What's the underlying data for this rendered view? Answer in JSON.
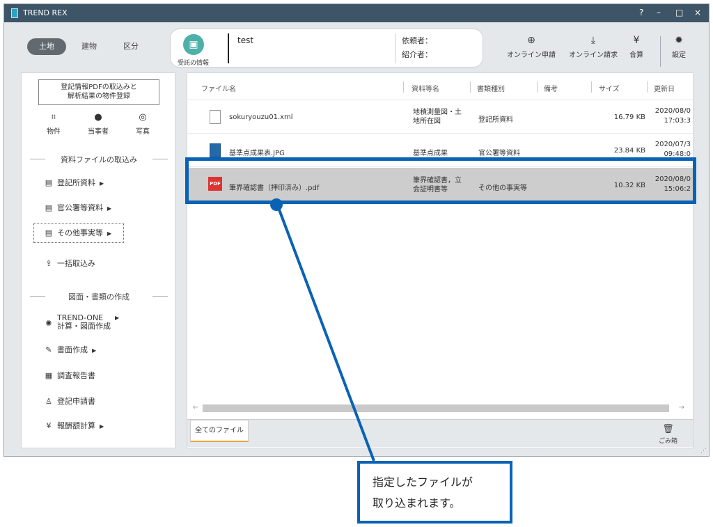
{
  "window": {
    "title": "TREND REX",
    "controls": [
      "?",
      "–",
      "□",
      "×"
    ]
  },
  "category_tabs": [
    {
      "label": "土地",
      "active": true
    },
    {
      "label": "建物",
      "active": false
    },
    {
      "label": "区分",
      "active": false
    }
  ],
  "context": {
    "entrust_label": "受託の情報",
    "project_name": "test",
    "requester": "依頼者：",
    "introducer": "紹介者："
  },
  "toolbar": [
    {
      "label": "オンライン申請",
      "icon": "globe-icon"
    },
    {
      "label": "オンライン請求",
      "icon": "download-icon"
    },
    {
      "label": "合算",
      "icon": "yen-icon"
    },
    {
      "label": "設定",
      "icon": "gear-icon"
    }
  ],
  "sidebar": {
    "import_button": [
      "登記情報PDFの取込みと",
      "解析結果の物件登録"
    ],
    "quick_items": [
      {
        "label": "物件",
        "icon": "property-icon"
      },
      {
        "label": "当事者",
        "icon": "person-icon"
      },
      {
        "label": "写真",
        "icon": "camera-icon"
      }
    ],
    "section1": "資料ファイルの取込み",
    "section1_items": [
      {
        "label": "登記所資料",
        "icon": "document-icon",
        "has_submenu": true
      },
      {
        "label": "官公署等資料",
        "icon": "document-icon",
        "has_submenu": true
      },
      {
        "label": "その他事実等",
        "icon": "document-icon",
        "has_submenu": true,
        "selected": true
      },
      {
        "label": "一括取込み",
        "icon": "batch-import-icon",
        "has_submenu": false
      }
    ],
    "section2": "図面・書類の作成",
    "section2_items": [
      {
        "label": "TREND-ONE\n計算・図面作成",
        "icon": "trend-one-icon",
        "has_submenu": true
      },
      {
        "label": "書面作成",
        "icon": "edit-document-icon",
        "has_submenu": true
      },
      {
        "label": "調査報告書",
        "icon": "report-icon",
        "has_submenu": false
      },
      {
        "label": "登記申請書",
        "icon": "application-icon",
        "has_submenu": false
      },
      {
        "label": "報酬額計算",
        "icon": "yen-icon",
        "has_submenu": true
      }
    ]
  },
  "file_table": {
    "columns": [
      "ファイル名",
      "資料等名",
      "書類種別",
      "備考",
      "サイズ",
      "更新日"
    ],
    "rows": [
      {
        "icon": "xml-file-icon",
        "name": "sokuryouzu01.xml",
        "doc_name": "地積測量図・土\n地所在図",
        "type": "登記所資料",
        "note": "",
        "size": "16.79 KB",
        "date": "2020/08/0",
        "time": "17:03:3",
        "selected": false
      },
      {
        "icon": "image-file-icon",
        "name": "基準点成果表.JPG",
        "doc_name": "基準点成果",
        "type": "官公署等資料",
        "note": "",
        "size": "23.84 KB",
        "date": "2020/07/3",
        "time": "09:48:0",
        "selected": false
      },
      {
        "icon": "pdf-file-icon",
        "name": "筆界確認書（押印済み）.pdf",
        "doc_name": "筆界確認書，立\n会証明書等",
        "type": "その他の事実等",
        "note": "",
        "size": "10.32 KB",
        "date": "2020/08/0",
        "time": "15:06:2",
        "selected": true
      }
    ]
  },
  "bottom": {
    "all_files_tab": "全てのファイル",
    "trash_label": "ごみ箱"
  },
  "callout": {
    "line1": "指定したファイルが",
    "line2": "取り込まれます。"
  },
  "colors": {
    "titlebar": "#3d5567",
    "accent_blue": "#0a62b5",
    "teal": "#4db0a9",
    "selected_row": "#cdcdcd"
  }
}
